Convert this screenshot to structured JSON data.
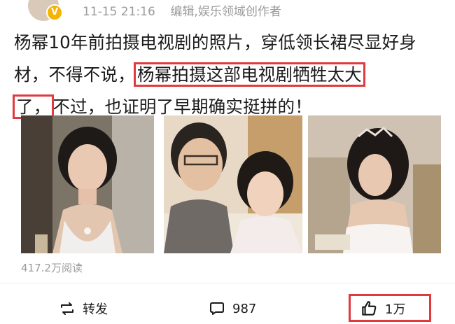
{
  "post": {
    "timestamp": "11-15 21:16",
    "author_tag": "编辑,娱乐领域创作者",
    "badge_icon": "verified-v-badge",
    "text_part1": "杨幂10年前拍摄电视剧的照片，穿低领长裙尽显好身材，不得不说，",
    "text_highlight1": "杨幂拍摄这部电视剧牺牲太大",
    "text_highlight2": "了，",
    "text_part2": "不过，也证明了早期确实挺拼的！",
    "highlight_color": "#e0393e"
  },
  "stats": {
    "reads": "417.2万阅读"
  },
  "actions": {
    "repost_label": "转发",
    "comment_count": "987",
    "like_count": "1万"
  }
}
